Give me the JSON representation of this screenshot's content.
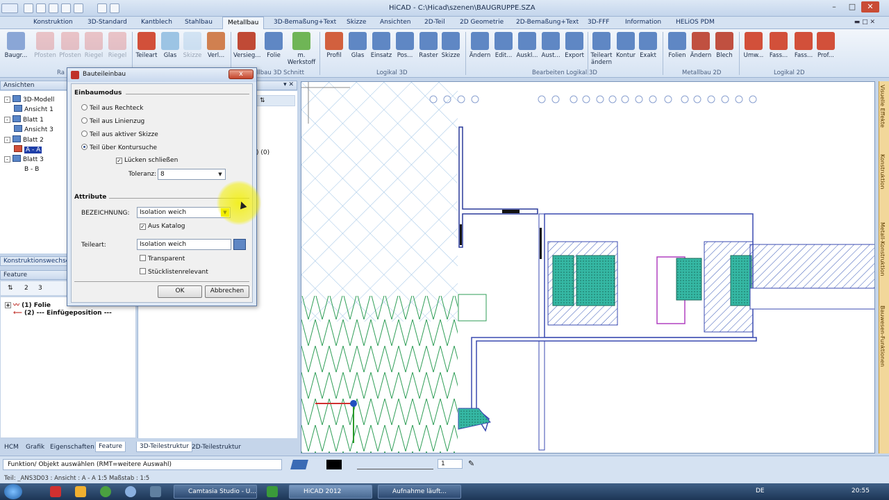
{
  "app": {
    "title": "HiCAD - C:\\Hicad\\szenen\\BAUGRUPPE.SZA"
  },
  "menu_tabs": [
    "Konstruktion",
    "3D-Standard",
    "Kantblech",
    "Stahlbau",
    "Metallbau",
    "3D-Bemaßung+Text",
    "Skizze",
    "Ansichten",
    "2D-Teil",
    "2D Geometrie",
    "2D-Bemaßung+Text",
    "3D-FFF",
    "Information",
    "HELiOS PDM"
  ],
  "menu_active": "Metallbau",
  "ribbon": {
    "buttons": [
      {
        "label": "Baugr..."
      },
      {
        "label": "Pfosten"
      },
      {
        "label": "Pfosten"
      },
      {
        "label": "Riegel"
      },
      {
        "label": "Riegel"
      },
      {
        "label": "Teileart"
      },
      {
        "label": "Glas"
      },
      {
        "label": "Skizze"
      },
      {
        "label": "Verl..."
      },
      {
        "label": "Versieg..."
      },
      {
        "label": "Folie"
      },
      {
        "label": "m. Werkstoff"
      },
      {
        "label": "Profil"
      },
      {
        "label": "Glas"
      },
      {
        "label": "Einsatz"
      },
      {
        "label": "Pos..."
      },
      {
        "label": "Raster"
      },
      {
        "label": "Skizze"
      },
      {
        "label": "Ändern"
      },
      {
        "label": "Edit..."
      },
      {
        "label": "Auskl..."
      },
      {
        "label": "Aust..."
      },
      {
        "label": "Export"
      },
      {
        "label": "Teileart ändern"
      },
      {
        "label": "Kontur"
      },
      {
        "label": "Exakt"
      },
      {
        "label": "Folien"
      },
      {
        "label": "Ändern"
      },
      {
        "label": "Blech"
      },
      {
        "label": "Umw..."
      },
      {
        "label": "Fass..."
      },
      {
        "label": "Fass..."
      },
      {
        "label": "Prof..."
      }
    ],
    "groups": [
      "Ra",
      "llbau 3D Schnitt",
      "Logikal 3D",
      "Bearbeiten Logikal 3D",
      "Metallbau 2D",
      "Logikal 2D"
    ]
  },
  "panels": {
    "ansichten_title": "Ansichten",
    "tree": [
      {
        "label": "3D-Modell",
        "exp": "-"
      },
      {
        "label": "Ansicht 1",
        "exp": ""
      },
      {
        "label": "Blatt 1",
        "exp": "-"
      },
      {
        "label": "Ansicht 3",
        "exp": ""
      },
      {
        "label": "Blatt 2",
        "exp": "-"
      },
      {
        "label": "A - A",
        "exp": ""
      },
      {
        "label": "Blatt 3",
        "exp": "-"
      },
      {
        "label": "B - B",
        "exp": ""
      }
    ],
    "mid_fragment": ") (0)",
    "konstruktion_title": "Konstruktionswechsel",
    "feature_title": "Feature",
    "feature_tb": [
      "2",
      "3"
    ],
    "feature_items": [
      {
        "label": "(1) Folie"
      },
      {
        "label": "(2) --- Einfügeposition ---"
      }
    ],
    "bottom_tabs": [
      "HCM",
      "Grafik",
      "Eigenschaften",
      "Feature",
      "3D-Teilestruktur",
      "2D-Teilestruktur"
    ]
  },
  "dialog": {
    "title": "Bauteileinbau",
    "close": "x",
    "einbaumodus_title": "Einbaumodus",
    "options": [
      "Teil aus Rechteck",
      "Teil aus Linienzug",
      "Teil aus aktiver Skizze",
      "Teil über Kontursuche"
    ],
    "selected_option": 3,
    "luecken": {
      "label": "Lücken schließen",
      "checked": true
    },
    "toleranz": {
      "label": "Toleranz:",
      "value": "8"
    },
    "attribute_title": "Attribute",
    "bezeichnung": {
      "label": "BEZEICHNUNG:",
      "value": "Isolation weich"
    },
    "aus_katalog": {
      "label": "Aus Katalog",
      "checked": true
    },
    "teileart": {
      "label": "Teileart:",
      "value": "Isolation weich"
    },
    "transparent": {
      "label": "Transparent",
      "checked": false
    },
    "stueckliste": {
      "label": "Stücklistenrelevant",
      "checked": false
    },
    "ok": "OK",
    "cancel": "Abbrechen"
  },
  "sidebar_tabs": [
    "Visuelle Effekte",
    "Konstruktion",
    "Metall-Konstruktion",
    "Bauwesen-Funktionen"
  ],
  "command": {
    "text": "Funktion/ Objekt auswählen (RMT=weitere Auswahl)",
    "line_width": "1"
  },
  "status": {
    "text": "Teil: _ANS3D03 : Ansicht : A - A 1:5 Maßstab : 1:5"
  },
  "taskbar": {
    "items": [
      "Camtasia Studio - U...",
      "HiCAD 2012",
      "Aufnahme läuft..."
    ],
    "lang": "DE",
    "time": "20:55"
  },
  "colors": {
    "accent": "#3a6bb5",
    "title_bg": "#c3d5ec",
    "hatch": "#2f9e57",
    "profile": "#5a6fd0",
    "insulation": "#33b3a0",
    "highlight": "#f3ef00"
  }
}
